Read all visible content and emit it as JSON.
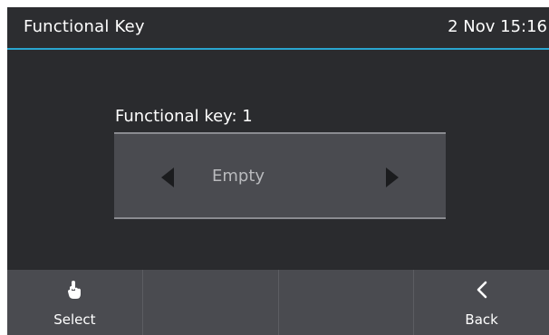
{
  "header": {
    "title": "Functional Key",
    "datetime": "2 Nov 15:16"
  },
  "field": {
    "label": "Functional key: 1",
    "value": "Empty"
  },
  "softkeys": [
    {
      "label": "Select",
      "icon": "tap-hand-icon"
    },
    {
      "label": "",
      "icon": ""
    },
    {
      "label": "",
      "icon": ""
    },
    {
      "label": "Back",
      "icon": "chevron-left-icon"
    }
  ],
  "colors": {
    "accent": "#2aa6cf",
    "background": "#2a2b2e",
    "panel": "#4a4b50"
  }
}
